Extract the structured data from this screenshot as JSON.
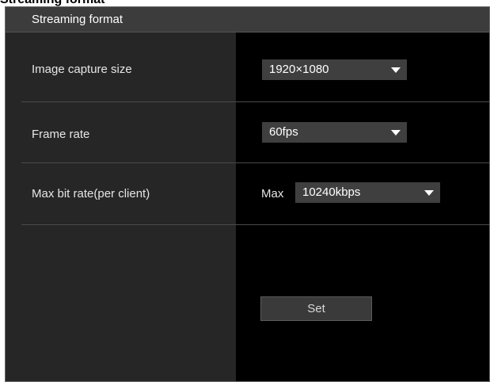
{
  "document": {
    "heading": "Streaming format"
  },
  "panel": {
    "title": "Streaming format",
    "rows": [
      {
        "label": "Image capture size",
        "value": "1920×1080"
      },
      {
        "label": "Frame rate",
        "value": "60fps"
      },
      {
        "label": "Max bit rate(per client)",
        "prefix": "Max",
        "value": "10240kbps"
      }
    ],
    "set_label": "Set"
  },
  "icons": {
    "dropdown": "chevron-down-icon"
  },
  "colors": {
    "panel_background": "#000000",
    "label_column": "#262626",
    "header": "#3c3c3c",
    "control": "#3f3f3f",
    "text": "#e6e6e6"
  }
}
